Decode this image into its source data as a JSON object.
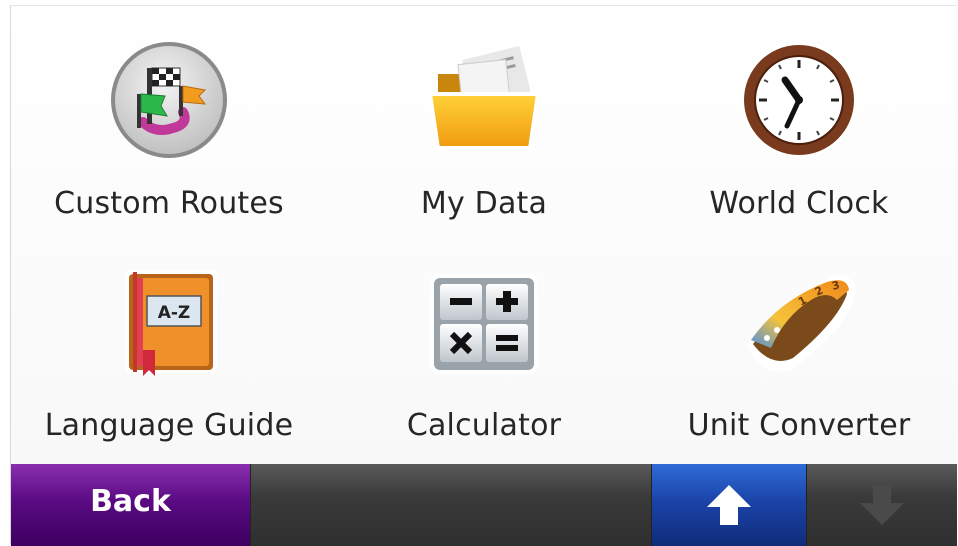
{
  "menu": {
    "items": [
      {
        "label": "Custom Routes",
        "icon": "custom-routes-icon"
      },
      {
        "label": "My Data",
        "icon": "folder-icon"
      },
      {
        "label": "World Clock",
        "icon": "clock-icon"
      },
      {
        "label": "Language Guide",
        "icon": "dictionary-book-icon"
      },
      {
        "label": "Calculator",
        "icon": "calculator-icon"
      },
      {
        "label": "Unit Converter",
        "icon": "tape-measure-icon"
      }
    ]
  },
  "bottom_bar": {
    "back_label": "Back",
    "up_icon": "arrow-up-icon",
    "down_icon": "arrow-down-icon",
    "down_enabled": false
  },
  "colors": {
    "back_button": "#5a0b82",
    "up_button": "#1b44a8",
    "bar": "#3a3a3a",
    "label_text": "#262626"
  }
}
